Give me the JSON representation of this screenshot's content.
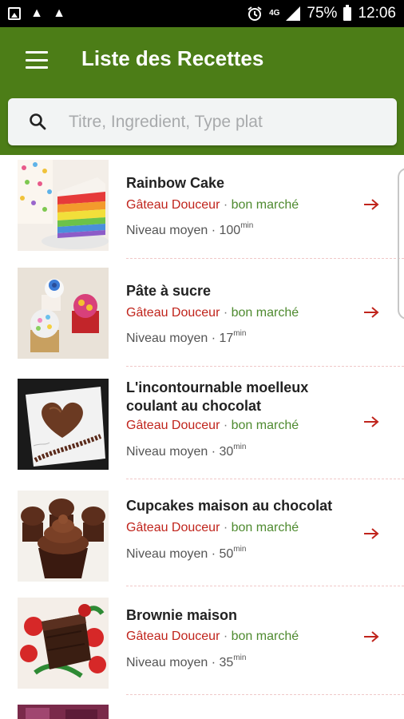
{
  "status_bar": {
    "network": "4G",
    "battery": "75%",
    "time": "12:06",
    "icons": [
      "image-icon",
      "rocket-icon",
      "rocket-icon",
      "alarm-icon",
      "signal-icon",
      "battery-icon"
    ]
  },
  "app_bar": {
    "title": "Liste des Recettes",
    "color": "#4c7d17"
  },
  "search": {
    "placeholder": "Titre, Ingredient, Type plat"
  },
  "recipes": [
    {
      "title": "Rainbow Cake",
      "category": "Gâteau Douceur",
      "separator": " · ",
      "price": "bon marché",
      "level": "Niveau moyen",
      "time": "100",
      "time_unit": "min"
    },
    {
      "title": "Pâte à sucre",
      "category": "Gâteau Douceur",
      "separator": " · ",
      "price": "bon marché",
      "level": "Niveau moyen",
      "time": "17",
      "time_unit": "min"
    },
    {
      "title": "L'incontournable moelleux coulant au chocolat",
      "category": "Gâteau Douceur",
      "separator": " · ",
      "price": "bon marché",
      "level": "Niveau moyen",
      "time": "30",
      "time_unit": "min"
    },
    {
      "title": "Cupcakes maison au chocolat",
      "category": "Gâteau Douceur",
      "separator": " · ",
      "price": "bon marché",
      "level": "Niveau moyen",
      "time": "50",
      "time_unit": "min"
    },
    {
      "title": "Brownie maison",
      "category": "Gâteau Douceur",
      "separator": " · ",
      "price": "bon marché",
      "level": "Niveau moyen",
      "time": "35",
      "time_unit": "min"
    }
  ],
  "meta_separator": " · ",
  "colors": {
    "category": "#c0241c",
    "price": "#4e8a2f",
    "arrow": "#c0241c"
  }
}
